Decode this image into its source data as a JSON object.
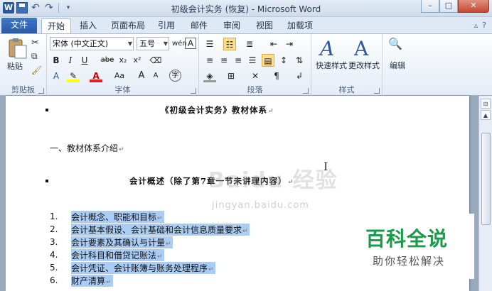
{
  "window": {
    "title": "初级会计实务 (恢复) - Microsoft Word",
    "app_icon": "W",
    "buttons": {
      "minimize": "–",
      "maximize": "□",
      "close": "✕"
    }
  },
  "ribbon_tabs": {
    "file": "文件",
    "tabs": [
      "开始",
      "插入",
      "页面布局",
      "引用",
      "邮件",
      "审阅",
      "视图",
      "加载项"
    ],
    "active": "开始"
  },
  "ribbon": {
    "clipboard": {
      "label": "剪贴板",
      "paste": "粘贴"
    },
    "font": {
      "label": "字体",
      "font_name": "宋体 (中文正文)",
      "font_size": "五号",
      "bold": "B",
      "italic": "I",
      "underline": "U",
      "strike": "abe",
      "subscript": "x₂",
      "superscript": "x²",
      "font_color": "A",
      "change_case": "Aa",
      "grow": "A",
      "shrink": "A",
      "wen_char": "wén",
      "phonetic": "A",
      "enclose": "字"
    },
    "paragraph": {
      "label": "段落"
    },
    "styles": {
      "label": "样式",
      "quick": "快速样式",
      "change": "更改样式"
    },
    "editing": {
      "label": "编辑"
    }
  },
  "document": {
    "title": "《初级会计实务》教材体系",
    "section_intro": "一、教材体系介绍",
    "chapter_heading": "会计概述（除了第7章一节未讲理内容）",
    "list_items": [
      {
        "num": "1.",
        "text": "会计概念、职能和目标"
      },
      {
        "num": "2.",
        "text": "会计基本假设、会计基础和会计信息质量要求"
      },
      {
        "num": "3.",
        "text": "会计要素及其确认与计量"
      },
      {
        "num": "4.",
        "text": "会计科目和借贷记账法"
      },
      {
        "num": "5.",
        "text": "会计凭证、会计账簿与账务处理程序"
      },
      {
        "num": "6.",
        "text": "财产清算"
      }
    ],
    "return_mark": "↵"
  },
  "watermark": {
    "baidu": "Baidu 经验",
    "url": "jingyan.baidu.com",
    "badge_title": "百科全说",
    "badge_sub": "助你轻松解决"
  },
  "colors": {
    "selection": "#aacdf5",
    "file_tab": "#2a5aa2",
    "badge_green": "#1b9a4a"
  }
}
